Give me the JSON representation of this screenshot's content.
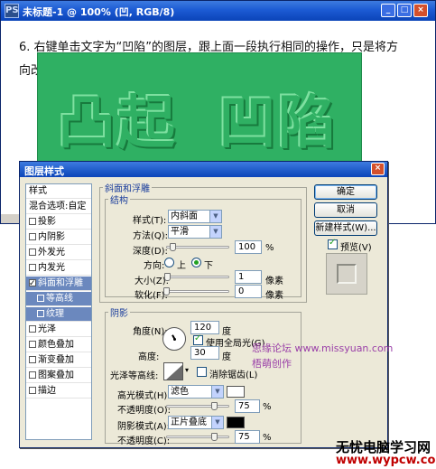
{
  "doc_window": {
    "title": "未标题-1 @ 100% (凹, RGB/8)",
    "app_icon_text": "PS",
    "minimize": "_",
    "maximize": "□",
    "close": "×"
  },
  "tutorial": {
    "line1": "6. 右键单击文字为“凹陷”的图层，跟上面一段执行相同的操作，只是将方",
    "line2": "向改为下即可。"
  },
  "canvas": {
    "text_left": "凸起",
    "text_right": "凹陷",
    "background_color": "#2fb063"
  },
  "dialog": {
    "title": "图层样式",
    "close": "×",
    "styles_header": "样式",
    "blend_options": "混合选项:自定",
    "style_items": [
      {
        "label": "投影",
        "checked": false
      },
      {
        "label": "内阴影",
        "checked": false
      },
      {
        "label": "外发光",
        "checked": false
      },
      {
        "label": "内发光",
        "checked": false
      },
      {
        "label": "斜面和浮雕",
        "checked": true
      },
      {
        "label": "等高线",
        "checked": false
      },
      {
        "label": "纹理",
        "checked": false
      },
      {
        "label": "光泽",
        "checked": false
      },
      {
        "label": "颜色叠加",
        "checked": false
      },
      {
        "label": "渐变叠加",
        "checked": false
      },
      {
        "label": "图案叠加",
        "checked": false
      },
      {
        "label": "描边",
        "checked": false
      }
    ],
    "bevel": {
      "group_title": "斜面和浮雕",
      "structure_title": "结构",
      "style_label": "样式(T):",
      "style_value": "内斜面",
      "technique_label": "方法(Q):",
      "technique_value": "平滑",
      "depth_label": "深度(D):",
      "depth_value": "100",
      "depth_percent": 100,
      "depth_unit": "%",
      "direction_label": "方向:",
      "direction_up": "上",
      "direction_down": "下",
      "direction_selected": "down",
      "size_label": "大小(Z):",
      "size_value": "1",
      "size_unit": "像素",
      "soften_label": "软化(F):",
      "soften_value": "0",
      "soften_unit": "像素"
    },
    "shading": {
      "group_title": "阴影",
      "angle_label": "角度(N):",
      "angle_value": "120",
      "angle_unit": "度",
      "global_light_label": "使用全局光(G)",
      "global_light_checked": true,
      "altitude_label": "高度:",
      "altitude_value": "30",
      "altitude_unit": "度",
      "gloss_contour_label": "光泽等高线:",
      "antialias_label": "消除锯齿(L)",
      "antialias_checked": false,
      "highlight_mode_label": "高光模式(H):",
      "highlight_mode_value": "滤色",
      "highlight_color": "#ffffff",
      "highlight_opacity_label": "不透明度(O):",
      "highlight_opacity_value": "75",
      "highlight_opacity_unit": "%",
      "highlight_opacity_percent": 75,
      "shadow_mode_label": "阴影模式(A):",
      "shadow_mode_value": "正片叠底",
      "shadow_color": "#000000",
      "shadow_opacity_label": "不透明度(C):",
      "shadow_opacity_value": "75",
      "shadow_opacity_unit": "%",
      "shadow_opacity_percent": 75
    },
    "buttons": {
      "ok": "确定",
      "cancel": "取消",
      "new_style": "新建样式(W)...",
      "preview_label": "预览(V)",
      "preview_checked": true
    }
  },
  "watermarks": {
    "forum": "思缘论坛  www.missyuan.com",
    "author": "梧萌创作",
    "site_name": "无忧电脑学习网",
    "site_url": "www.wypcw.com"
  }
}
